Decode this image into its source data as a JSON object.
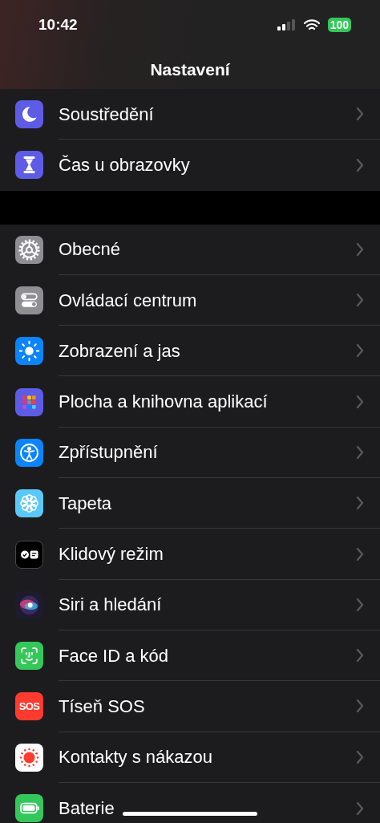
{
  "status_bar": {
    "time": "10:42",
    "battery": "100"
  },
  "title": "Nastavení",
  "groups": [
    {
      "items": [
        {
          "kind": "moon",
          "label": "Soustředění"
        },
        {
          "kind": "hourglass",
          "label": "Čas u obrazovky"
        }
      ]
    },
    {
      "items": [
        {
          "kind": "gear",
          "label": "Obecné"
        },
        {
          "kind": "toggles",
          "label": "Ovládací centrum"
        },
        {
          "kind": "sun",
          "label": "Zobrazení a jas"
        },
        {
          "kind": "grid",
          "label": "Plocha a knihovna aplikací"
        },
        {
          "kind": "accessibility",
          "label": "Zpřístupnění"
        },
        {
          "kind": "flower",
          "label": "Tapeta"
        },
        {
          "kind": "standby",
          "label": "Klidový režim"
        },
        {
          "kind": "siri",
          "label": "Siri a hledání"
        },
        {
          "kind": "faceid",
          "label": "Face ID a kód"
        },
        {
          "kind": "sos",
          "label": "Tíseň SOS",
          "icon_text": "SOS"
        },
        {
          "kind": "exposure",
          "label": "Kontakty s nákazou"
        },
        {
          "kind": "battery",
          "label": "Baterie"
        }
      ]
    }
  ]
}
